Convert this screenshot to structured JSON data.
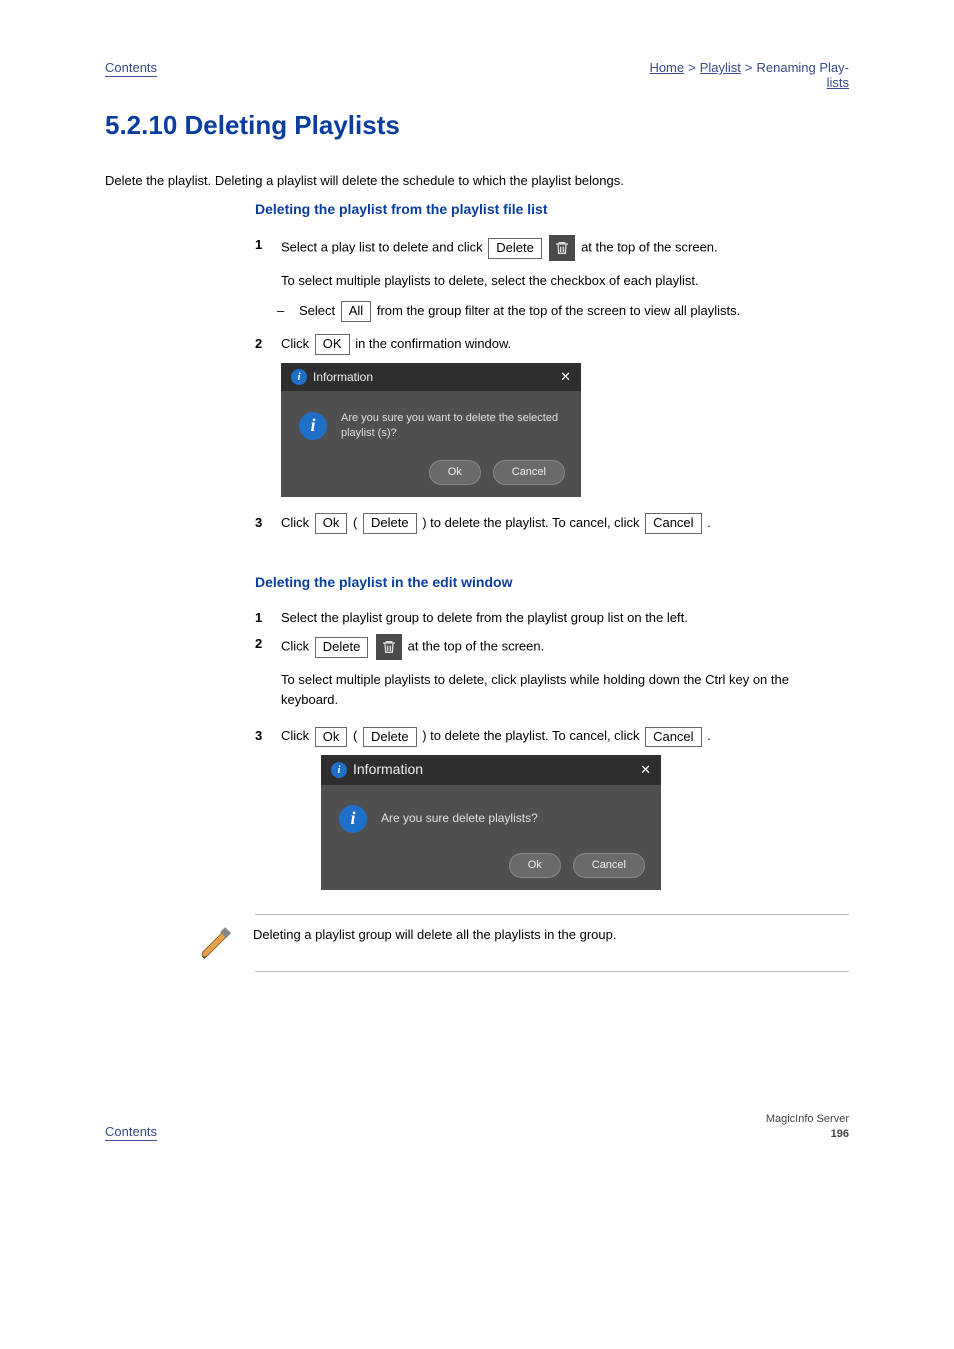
{
  "header": {
    "left": "Contents",
    "right_top": [
      "Home",
      ">",
      "Playlist",
      ">",
      "Renaming Play-"
    ],
    "right_bottom": "lists"
  },
  "section_title": "5.2.10  Deleting  Playlists",
  "intro": "Delete the playlist. Deleting a playlist will delete the schedule to which the playlist belongs.",
  "group1": {
    "heading": "Deleting the playlist from the playlist file list",
    "step1_pre": "Select a play list to delete and click ",
    "step1_btn": "Delete",
    "step1_post": " at the top of the screen.",
    "tip": "To select multiple playlists to delete, select the checkbox of each playlist.",
    "sub1_pre": "Select ",
    "sub1_btn": "All",
    "sub1_post": " from the group filter at the top of the screen to view all playlists.",
    "step2_pre": "Click ",
    "step2_btn": "OK",
    "step2_post": " in the confirmation window.",
    "dlg_title": "Information",
    "dlg_msg": "Are you sure you want to delete the selected playlist (s)?",
    "dlg_ok": "Ok",
    "dlg_cancel": "Cancel",
    "step3_a": "Click ",
    "step3_ok": "Ok",
    "step3_b": " (",
    "step3_delete": "Delete",
    "step3_c": ") to delete the playlist. To cancel, click ",
    "step3_cancel": "Cancel",
    "step3_d": "."
  },
  "group2": {
    "heading": "Deleting the playlist in the edit window",
    "step1": "Select the playlist group to delete from the playlist group list on the left.",
    "step2_pre": "Click ",
    "step2_btn": "Delete",
    "step2_post": " at the top of the screen.",
    "tip": "To select multiple playlists to delete, click playlists while holding down the Ctrl key on the keyboard.",
    "step3_a": "Click ",
    "step3_ok": "Ok",
    "step3_b": " (",
    "step3_delete": "Delete",
    "step3_c": ") to delete the playlist. To cancel, click ",
    "step3_cancel": "Cancel",
    "step3_d": ".",
    "dlg_title": "Information",
    "dlg_msg": "Are you sure delete playlists?",
    "dlg_ok": "Ok",
    "dlg_cancel": "Cancel"
  },
  "note": "Deleting a playlist group will delete all the playlists in the group.",
  "footer": {
    "left": "Contents",
    "line1": "MagicInfo Server",
    "line2": "196"
  }
}
